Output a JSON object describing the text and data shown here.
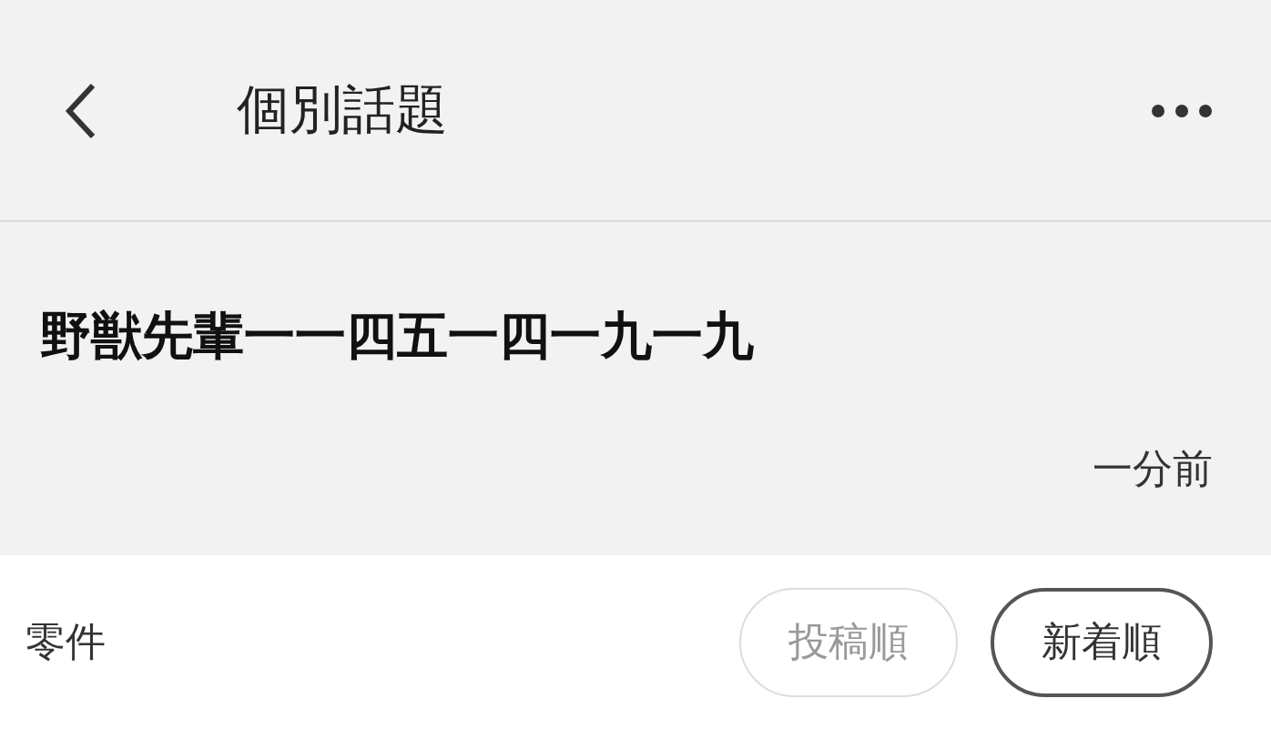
{
  "header": {
    "title": "個別話題"
  },
  "topic": {
    "title": "野獣先輩一一四五一四一九一九",
    "time": "一分前"
  },
  "sort_bar": {
    "label": "零件",
    "options": [
      {
        "label": "投稿順",
        "selected": false
      },
      {
        "label": "新着順",
        "selected": true
      }
    ]
  }
}
